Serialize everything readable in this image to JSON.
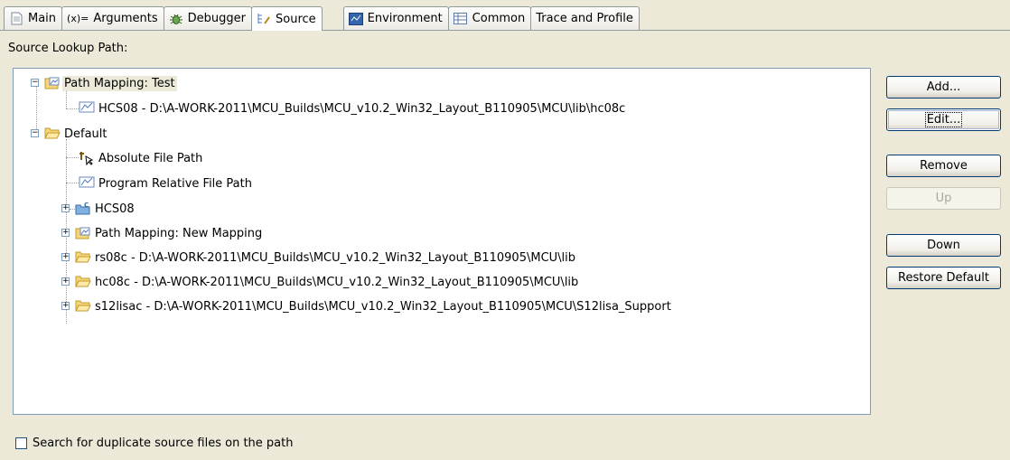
{
  "tabs": [
    {
      "label": "Main",
      "icon": "document-icon"
    },
    {
      "label": "Arguments",
      "icon": "arguments-icon",
      "glyph": "(x)="
    },
    {
      "label": "Debugger",
      "icon": "bug-icon"
    },
    {
      "label": "Source",
      "icon": "source-icon",
      "active": true
    },
    {
      "label": "Environment",
      "icon": "environment-icon"
    },
    {
      "label": "Common",
      "icon": "common-icon"
    },
    {
      "label": "Trace and Profile",
      "icon": ""
    }
  ],
  "source_lookup_label": "Source Lookup Path:",
  "tree": {
    "items": [
      {
        "label": "Path Mapping: Test",
        "icon": "path-mapping-icon",
        "expanded": true,
        "selected": true
      },
      {
        "label": "HCS08 - D:\\A-WORK-2011\\MCU_Builds\\MCU_v10.2_Win32_Layout_B110905\\MCU\\lib\\hc08c",
        "icon": "path-mapping-entry-icon"
      },
      {
        "label": "Default",
        "icon": "folder-open-icon",
        "expanded": true
      },
      {
        "label": "Absolute File Path",
        "icon": "absolute-path-icon"
      },
      {
        "label": "Program Relative File Path",
        "icon": "path-mapping-entry-icon"
      },
      {
        "label": "HCS08",
        "icon": "project-folder-icon"
      },
      {
        "label": "Path Mapping: New Mapping",
        "icon": "path-mapping-icon"
      },
      {
        "label": "rs08c - D:\\A-WORK-2011\\MCU_Builds\\MCU_v10.2_Win32_Layout_B110905\\MCU\\lib",
        "icon": "folder-icon"
      },
      {
        "label": "hc08c - D:\\A-WORK-2011\\MCU_Builds\\MCU_v10.2_Win32_Layout_B110905\\MCU\\lib",
        "icon": "folder-icon"
      },
      {
        "label": "s12lisac - D:\\A-WORK-2011\\MCU_Builds\\MCU_v10.2_Win32_Layout_B110905\\MCU\\S12lisa_Support",
        "icon": "folder-icon"
      }
    ]
  },
  "buttons": {
    "add": "Add...",
    "edit": "Edit...",
    "remove": "Remove",
    "up": "Up",
    "down": "Down",
    "restore": "Restore Default"
  },
  "search_duplicates": {
    "label": "Search for duplicate source files on the path",
    "checked": false
  }
}
